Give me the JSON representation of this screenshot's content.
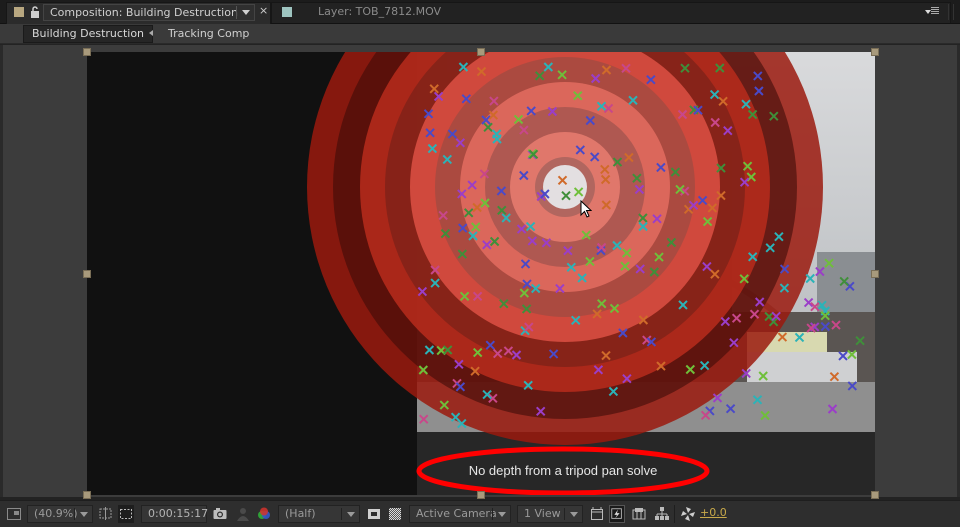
{
  "panel": {
    "active_tab_label": "Composition: Building Destruction",
    "inactive_tab_label": "Layer: TOB_7812.MOV",
    "close_glyph": "×",
    "comp_swatch_color": "#b8a780",
    "layer_swatch_color": "#9ec4c0"
  },
  "breadcrumb": {
    "current": "Building Destruction",
    "parent": "Tracking Comp"
  },
  "viewer": {
    "annotation_text": "No depth from a tripod pan solve",
    "annotation_color": "#ff0000",
    "overlay_color": "#e8392a"
  },
  "toolbar": {
    "magnification": "(40.9%)",
    "timecode": "0:00:15:17",
    "resolution": "(Half)",
    "camera": "Active Camera",
    "view_layout": "1 View",
    "exposure": "+0.0",
    "exposure_color": "#c8a94a",
    "icons": [
      "always-preview-icon",
      "region-of-interest-icon",
      "transparency-grid-toggle-icon",
      "snapshot-camera-icon",
      "show-snapshot-icon",
      "rgb-channel-icon",
      "fast-previews-icon",
      "toggle-mask-icon",
      "checkerboard-icon",
      "draft-3d-icon",
      "fast-previews-lightning-icon",
      "timeline-icon",
      "flowchart-icon",
      "reset-exposure-icon"
    ]
  }
}
